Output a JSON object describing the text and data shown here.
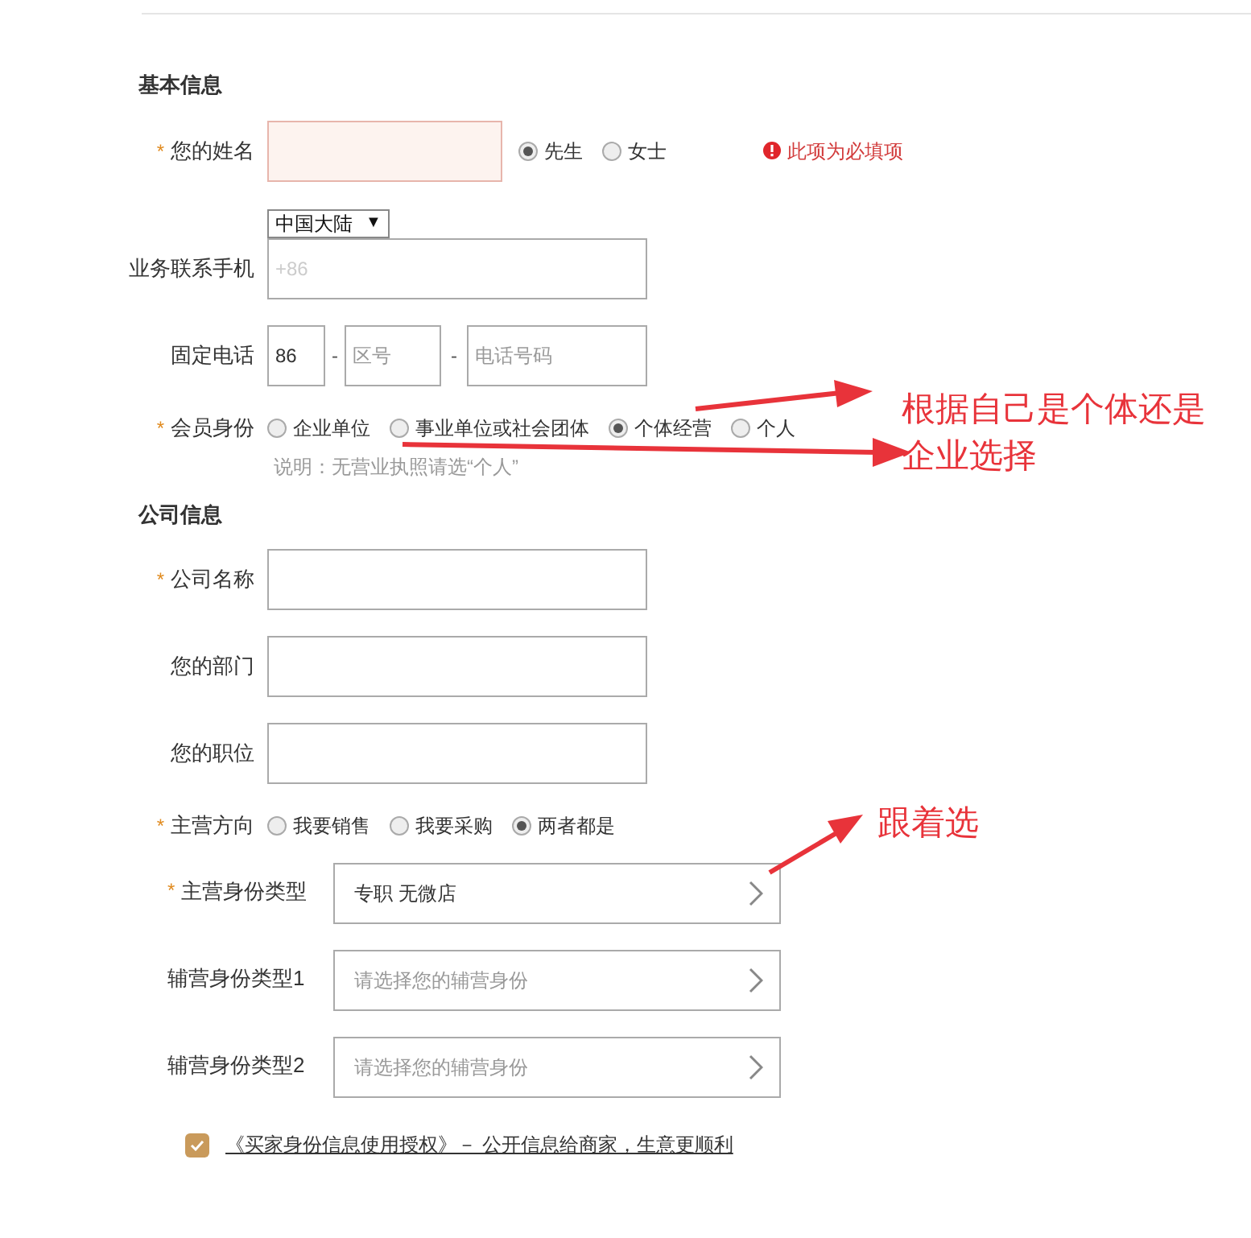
{
  "basic": {
    "title": "基本信息",
    "name": {
      "mark": "*",
      "label": "您的姓名",
      "error": true,
      "options": [
        {
          "label": "先生",
          "selected": true
        },
        {
          "label": "女士",
          "selected": false
        }
      ],
      "message": "此项为必填项"
    },
    "mobile": {
      "label": "业务联系手机",
      "region": "中国大陆",
      "region_caret": "▼",
      "placeholder": "+86"
    },
    "landline": {
      "label": "固定电话",
      "country": "86",
      "separator": "-",
      "area_placeholder": "区号",
      "number_placeholder": "电话号码"
    },
    "member": {
      "mark": "*",
      "label": "会员身份",
      "options": [
        {
          "label": "企业单位",
          "selected": false
        },
        {
          "label": "事业单位或社会团体",
          "selected": false
        },
        {
          "label": "个体经营",
          "selected": true
        },
        {
          "label": "个人",
          "selected": false
        }
      ],
      "note": "说明：无营业执照请选“个人”"
    }
  },
  "company": {
    "title": "公司信息",
    "fields": [
      {
        "mark": "*",
        "label": "公司名称"
      },
      {
        "label": "您的部门"
      },
      {
        "label": "您的职位"
      }
    ],
    "direction": {
      "mark": "*",
      "label": "主营方向",
      "options": [
        {
          "label": "我要销售",
          "selected": false
        },
        {
          "label": "我要采购",
          "selected": false
        },
        {
          "label": "两者都是",
          "selected": true
        }
      ]
    },
    "selectors": [
      {
        "mark": "*",
        "label": "主营身份类型",
        "value": "专职 无微店"
      },
      {
        "label": "辅营身份类型1",
        "placeholder": "请选择您的辅营身份"
      },
      {
        "label": "辅营身份类型2",
        "placeholder": "请选择您的辅营身份"
      }
    ]
  },
  "agreement": {
    "checked": true,
    "link": "《买家身份信息使用授权》－ 公开信息给商家，生意更顺利"
  },
  "annotations": [
    {
      "text": "根据自己是个体还是企业选择"
    },
    {
      "text": "跟着选"
    }
  ]
}
